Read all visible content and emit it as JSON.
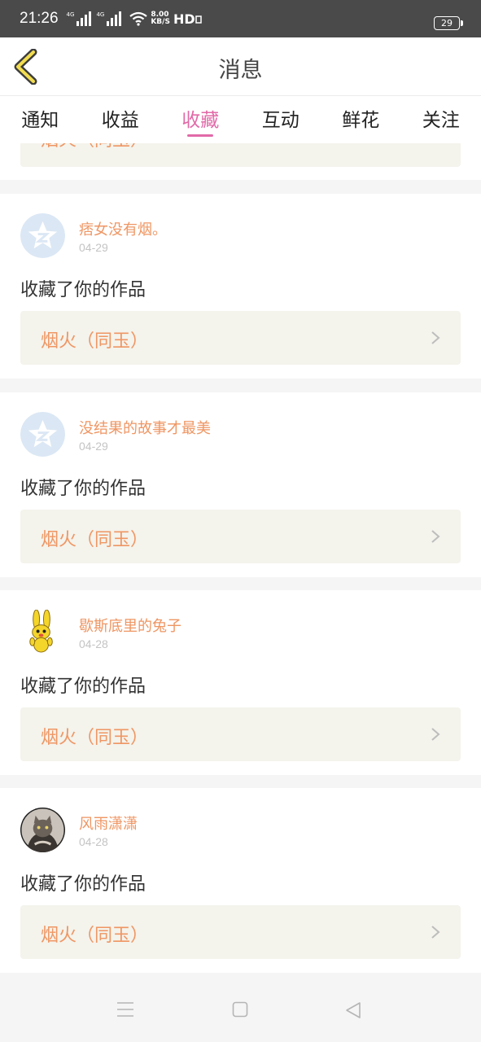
{
  "status_bar": {
    "time": "21:26",
    "signal1_label": "4G",
    "signal2_label": "4G",
    "net_speed_value": "8.00",
    "net_speed_unit": "KB/S",
    "hd_label": "HD",
    "battery": "29"
  },
  "header": {
    "title": "消息",
    "back_icon": "chevron-left-icon"
  },
  "tabs": [
    {
      "label": "通知",
      "active": false
    },
    {
      "label": "收益",
      "active": false
    },
    {
      "label": "收藏",
      "active": true
    },
    {
      "label": "互动",
      "active": false
    },
    {
      "label": "鲜花",
      "active": false
    },
    {
      "label": "关注",
      "active": false
    }
  ],
  "partial_item": {
    "work_title": "烟火（同玉）"
  },
  "items": [
    {
      "user": "痞女没有烟。",
      "date": "04-29",
      "action": "收藏了你的作品",
      "work_title": "烟火（同玉）",
      "avatar": "qzone-default-avatar"
    },
    {
      "user": "没结果的故事才最美",
      "date": "04-29",
      "action": "收藏了你的作品",
      "work_title": "烟火（同玉）",
      "avatar": "qzone-default-avatar"
    },
    {
      "user": "歇斯底里的兔子",
      "date": "04-28",
      "action": "收藏了你的作品",
      "work_title": "烟火（同玉）",
      "avatar": "cartoon-rabbit-avatar"
    },
    {
      "user": "风雨潇潇",
      "date": "04-28",
      "action": "收藏了你的作品",
      "work_title": "烟火（同玉）",
      "avatar": "cat-photo-avatar"
    }
  ],
  "colors": {
    "accent_tab": "#e16aa8",
    "username": "#ef9663",
    "work_bg": "#f4f3ec",
    "status_bar": "#4a4a4a"
  },
  "nav_bar": {
    "menu_icon": "menu-icon",
    "home_icon": "square-home-icon",
    "back_icon": "triangle-back-icon"
  }
}
